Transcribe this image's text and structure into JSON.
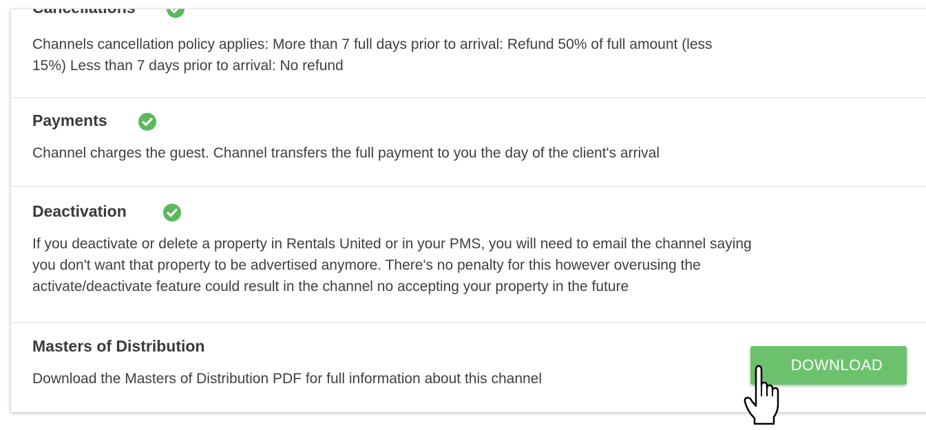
{
  "sections": {
    "cancellations": {
      "title": "Cancellations",
      "text_line1": "Channels cancellation policy applies: More than 7 full days prior to arrival: Refund 50% of full amount (less",
      "text_line2": "15%) Less than 7 days prior to arrival: No refund"
    },
    "payments": {
      "title": "Payments",
      "text": "Channel charges the guest. Channel transfers the full payment to you the day of the client's arrival"
    },
    "deactivation": {
      "title": "Deactivation",
      "text_line1": "If you deactivate or delete a property in Rentals United or in your PMS, you will need to email the channel saying",
      "text_line2": "you don't want that property to be advertised anymore. There's no penalty for this however overusing the",
      "text_line3": "activate/deactivate feature could result in the channel no accepting your property in the future"
    },
    "masters": {
      "title": "Masters of Distribution",
      "text": "Download the Masters of Distribution PDF for full information about this channel",
      "button_label": "DOWNLOAD"
    }
  },
  "icons": {
    "status": "check-circle-icon",
    "cursor": "hand-pointer-icon"
  },
  "colors": {
    "check_green": "#5cb85c",
    "button_green": "#6cc26c",
    "heading": "#3a3a3a",
    "text": "#3f3f3f"
  }
}
